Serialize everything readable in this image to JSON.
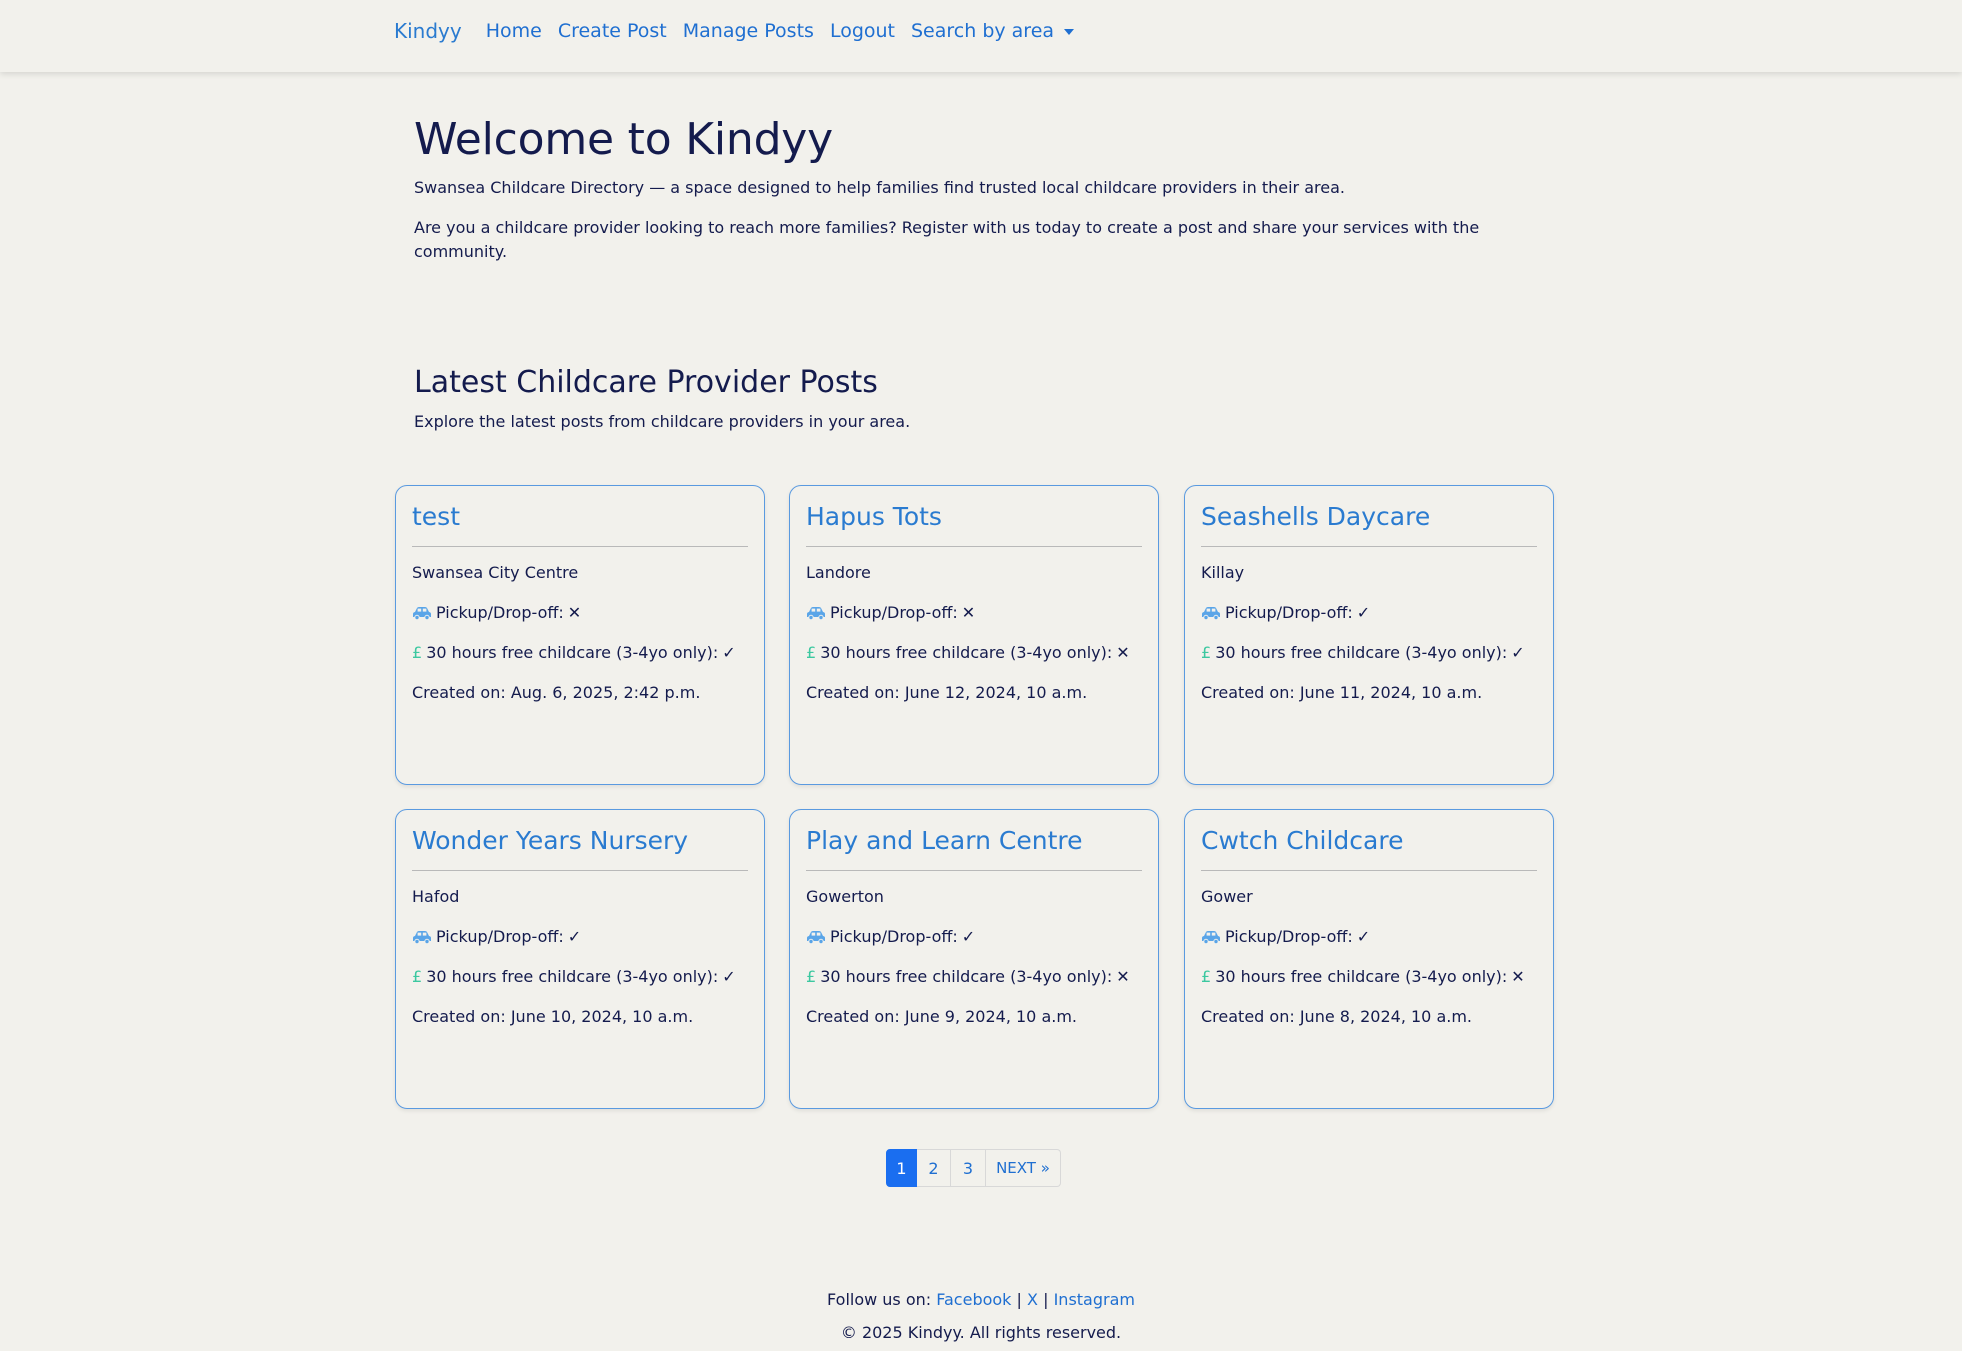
{
  "nav": {
    "brand": "Kindyy",
    "links": [
      "Home",
      "Create Post",
      "Manage Posts",
      "Logout"
    ],
    "dropdown_label": "Search by area"
  },
  "hero": {
    "title": "Welcome to Kindyy",
    "subtitle": "Swansea Childcare Directory — a space designed to help families find trusted local childcare providers in their area.",
    "body": "Are you a childcare provider looking to reach more families? Register with us today to create a post and share your services with the community."
  },
  "latest": {
    "title": "Latest Childcare Provider Posts",
    "subtitle": "Explore the latest posts from childcare providers in your area."
  },
  "labels": {
    "pickup": "Pickup/Drop-off:",
    "free": "30 hours free childcare (3-4yo only):",
    "created_prefix": "Created on:",
    "pound": "£",
    "yes": "✓",
    "no": "✕"
  },
  "posts": [
    {
      "title": "test",
      "area": "Swansea City Centre",
      "pickup": false,
      "free": true,
      "created": "Aug. 6, 2025, 2:42 p.m."
    },
    {
      "title": "Hapus Tots",
      "area": "Landore",
      "pickup": false,
      "free": false,
      "created": "June 12, 2024, 10 a.m."
    },
    {
      "title": "Seashells Daycare",
      "area": "Killay",
      "pickup": true,
      "free": true,
      "created": "June 11, 2024, 10 a.m."
    },
    {
      "title": "Wonder Years Nursery",
      "area": "Hafod",
      "pickup": true,
      "free": true,
      "created": "June 10, 2024, 10 a.m."
    },
    {
      "title": "Play and Learn Centre",
      "area": "Gowerton",
      "pickup": true,
      "free": false,
      "created": "June 9, 2024, 10 a.m."
    },
    {
      "title": "Cwtch Childcare",
      "area": "Gower",
      "pickup": true,
      "free": false,
      "created": "June 8, 2024, 10 a.m."
    }
  ],
  "pagination": {
    "pages": [
      "1",
      "2",
      "3"
    ],
    "current": "1",
    "next": "NEXT »"
  },
  "footer": {
    "follow": "Follow us on:",
    "links": [
      "Facebook",
      "X",
      "Instagram"
    ],
    "separator": "|",
    "copyright": "© 2025 Kindyy. All rights reserved."
  },
  "colors": {
    "background": "#f2f1ec",
    "link": "#1f6fd1",
    "card_border": "#5a9ae0",
    "pagination_active": "#1a6ef0",
    "pound": "#3cc8a0",
    "car_icon": "#5aa5e8"
  }
}
